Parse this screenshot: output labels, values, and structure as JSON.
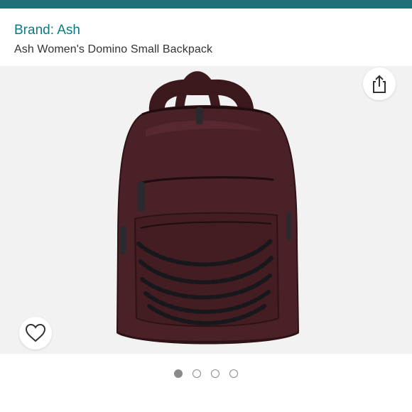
{
  "header": {
    "accent_color": "#1f6f78"
  },
  "product": {
    "brand_label": "Brand: Ash",
    "title": "Ash Women's Domino Small Backpack",
    "image_subject": "burgundy leather backpack with black chains",
    "bag_color": "#4a2126"
  },
  "actions": {
    "share_icon": "share-icon",
    "wishlist_icon": "heart-outline-icon"
  },
  "carousel": {
    "count": 4,
    "active_index": 0
  }
}
